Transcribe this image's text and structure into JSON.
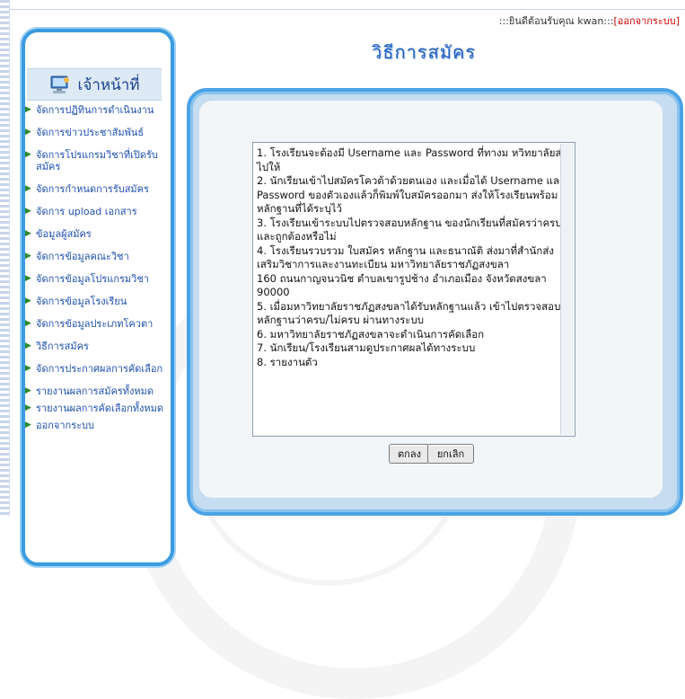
{
  "header": {
    "greeting_prefix": ":::ยินดีต้อนรับคุณ kwan:::",
    "logout_label": "[ออกจากระบบ]"
  },
  "page": {
    "title": "วิธีการสมัคร"
  },
  "sidebar": {
    "heading": "เจ้าหน้าที่",
    "items": [
      {
        "label": "จัดการปฏิทินการดำเนินงาน"
      },
      {
        "label": "จัดการข่าวประชาสัมพันธ์"
      },
      {
        "label": "จัดการโปรแกรมวิชาที่เปิดรับสมัคร"
      },
      {
        "label": "จัดการกำหนดการรับสมัคร"
      },
      {
        "label": "จัดการ upload เอกสาร"
      },
      {
        "label": "ข้อมูลผู้สมัคร"
      },
      {
        "label": "จัดการข้อมูลคณะวิชา"
      },
      {
        "label": "จัดการข้อมูลโปรแกรมวิชา"
      },
      {
        "label": "จัดการข้อมูลโรงเรียน"
      },
      {
        "label": "จัดการข้อมูลประเภทโควตา"
      },
      {
        "label": "วิธีการสมัคร"
      },
      {
        "label": "จัดการประกาศผลการคัดเลือก"
      },
      {
        "label": "รายงานผลการสมัครทั้งหมด"
      },
      {
        "label": "รายงานผลการคัดเลือกทั้งหมด"
      },
      {
        "label": "ออกจากระบบ"
      }
    ]
  },
  "content": {
    "lines": [
      "1. โรงเรียนจะต้องมี Username และ Password ที่ทางม หวิทยาลัยส่งไปให้",
      "2. นักเรียนเข้าไปสมัครโควต้าด้วยตนเอง และเมื่อได้ Username และ Password ของตัวเองแล้วก็พิมพ์ใบสมัครออกมา ส่งให้โรงเรียนพร้อมหลักฐานที่ได้ระบุไว้",
      "3. โรงเรียนเข้าระบบไปตรวจสอบหลักฐาน ของนักเรียนที่สมัครว่าครบและถูกต้องหรือไม่",
      "4. โรงเรียนรวบรวม ใบสมัคร หลักฐาน และธนาณัติ ส่งมาที่สำนักส่งเสริมวิชาการและงานทะเบียน มหาวิทยาลัยราชภัฏสงขลา",
      "160 ถนนกาญจนวนิช ตำบลเขารูปช้าง อำเภอเมือง จังหวัดสงขลา 90000",
      "5. เมื่อมหาวิทยาลัยราชภัฏสงขลาได้รับหลักฐานแล้ว เข้าไปตรวจสอบหลักฐานว่าครบ/ไม่ครบ ผ่านทางระบบ",
      "6. มหาวิทยาลัยราชภัฏสงขลาจะดำเนินการคัดเลือก",
      "7. นักเรียน/โรงเรียนสามดูประกาศผลได้ทางระบบ",
      "8. รายงานตัว"
    ]
  },
  "buttons": {
    "ok_label": "ตกลง",
    "cancel_label": "ยกเลิก"
  },
  "colors": {
    "accent": "#3a9be0",
    "title": "#1f5fc2",
    "link": "#1c4fb0",
    "logout": "#cc0000"
  }
}
